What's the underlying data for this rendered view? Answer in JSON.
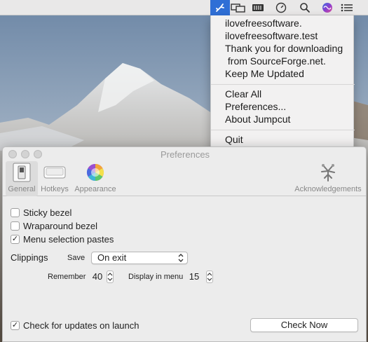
{
  "menubar": {
    "icons": [
      "jumpcut-icon",
      "display-mirror-icon",
      "memory-icon",
      "clock-icon",
      "search-icon",
      "siri-icon",
      "notification-center-icon"
    ]
  },
  "dropdown": {
    "clippings": [
      "ilovefreesoftware.",
      "ilovefreesoftware.test",
      "Thank you for downloading",
      " from SourceForge.net.",
      "Keep Me Updated"
    ],
    "clear_all": "Clear All",
    "preferences": "Preferences...",
    "about": "About Jumpcut",
    "quit": "Quit"
  },
  "prefs": {
    "title": "Preferences",
    "toolbar": {
      "general": "General",
      "hotkeys": "Hotkeys",
      "appearance": "Appearance",
      "acknowledgements": "Acknowledgements"
    },
    "checkboxes": {
      "sticky_bezel": {
        "label": "Sticky bezel",
        "checked": false
      },
      "wraparound_bezel": {
        "label": "Wraparound bezel",
        "checked": false
      },
      "menu_selection_pastes": {
        "label": "Menu selection pastes",
        "checked": true
      },
      "check_updates": {
        "label": "Check for updates on launch",
        "checked": true
      }
    },
    "clippings_label": "Clippings",
    "save_label": "Save",
    "save_value": "On exit",
    "remember_label": "Remember",
    "remember_value": "40",
    "display_in_menu_label": "Display in menu",
    "display_in_menu_value": "15",
    "check_now": "Check Now"
  },
  "colors": {
    "accent": "#2f6fd6",
    "menu_bg": "#f2f1f1",
    "window_bg": "#ececec"
  }
}
